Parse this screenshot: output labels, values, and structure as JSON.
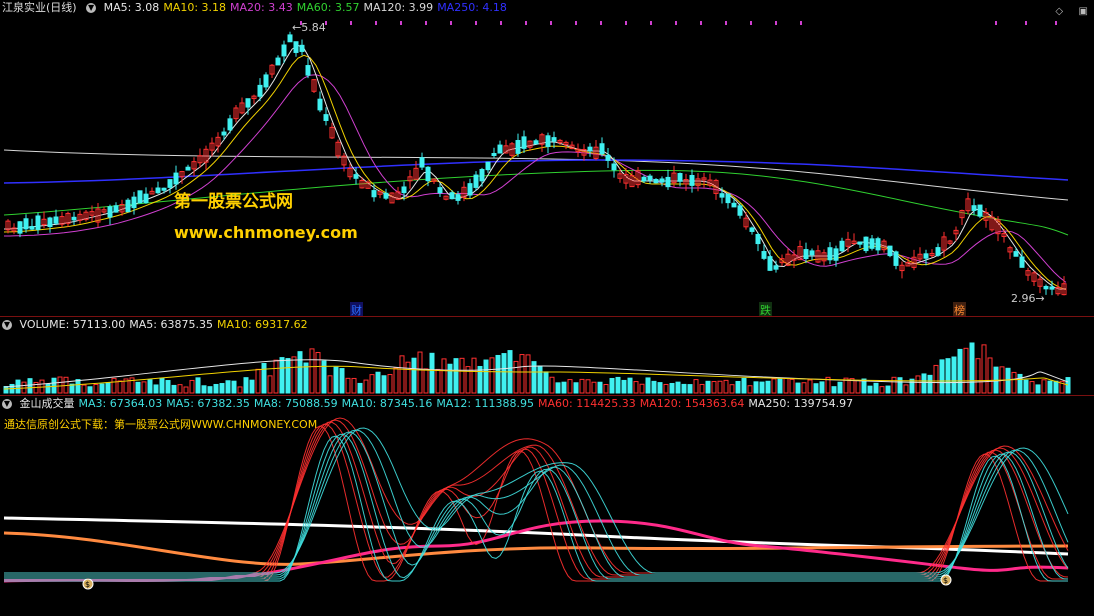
{
  "main_panel": {
    "stock_name": "江泉实业(日线)",
    "ma_labels": [
      {
        "text": "MA5: 3.08",
        "color": "#e6e6e6"
      },
      {
        "text": "MA10: 3.18",
        "color": "#f2d200"
      },
      {
        "text": "MA20: 3.43",
        "color": "#d040d0"
      },
      {
        "text": "MA60: 3.57",
        "color": "#30d030"
      },
      {
        "text": "MA120: 3.99",
        "color": "#d8d8d8"
      },
      {
        "text": "MA250: 4.18",
        "color": "#3030ff"
      }
    ],
    "high_label": "5.84",
    "low_label": "2.96",
    "events": [
      {
        "text": "财",
        "color": "#2a6cff"
      },
      {
        "text": "跌",
        "color": "#30d030"
      },
      {
        "text": "榜",
        "color": "#ff8a30"
      }
    ],
    "watermark_cn": "第一股票公式网",
    "watermark_url": "www.chnmoney.com"
  },
  "volume_panel": {
    "labels": [
      {
        "text": "VOLUME: 57113.00",
        "color": "#e6e6e6"
      },
      {
        "text": "MA5: 63875.35",
        "color": "#e6e6e6"
      },
      {
        "text": "MA10: 69317.62",
        "color": "#f2d200"
      }
    ]
  },
  "indicator_panel": {
    "labels": [
      {
        "text": "金山成交量",
        "color": "#e6e6e6"
      },
      {
        "text": "MA3: 67364.03",
        "color": "#40e0e0"
      },
      {
        "text": "MA5: 67382.35",
        "color": "#40e0e0"
      },
      {
        "text": "MA8: 75088.59",
        "color": "#40e0e0"
      },
      {
        "text": "MA10: 87345.16",
        "color": "#40e0e0"
      },
      {
        "text": "MA12: 111388.95",
        "color": "#40e0e0"
      },
      {
        "text": "MA60: 114425.33",
        "color": "#ff3030"
      },
      {
        "text": "MA120: 154363.64",
        "color": "#ff3030"
      },
      {
        "text": "MA250: 139754.97",
        "color": "#e6e6e6"
      }
    ],
    "notice": "通达信原创公式下载：第一股票公式网WWW.CHNMONEY.COM",
    "money_bag_icon": "$"
  },
  "colors": {
    "up_candle": "#ff3030",
    "down_candle": "#40f0f0",
    "separator": "#7a1010"
  }
}
